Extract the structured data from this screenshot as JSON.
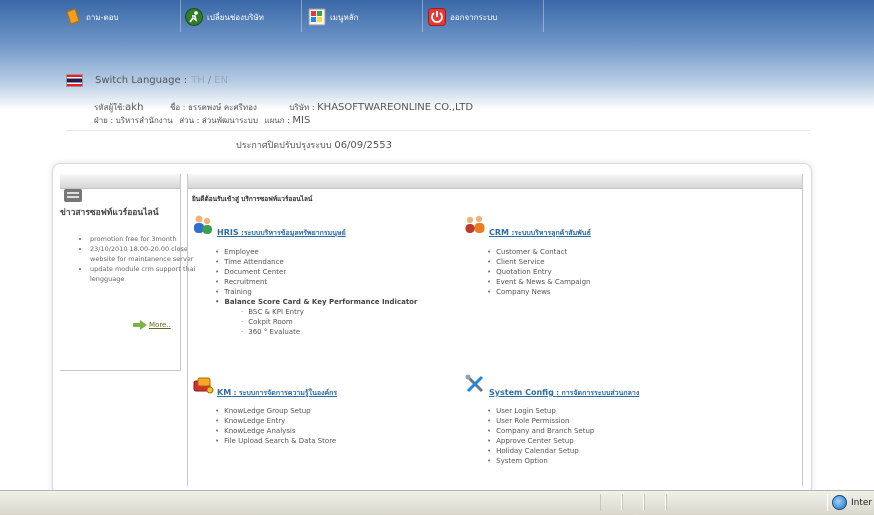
{
  "nav": {
    "items": [
      {
        "label": "ถาม-ตอบ",
        "icon": "qa-book-icon",
        "color": "#f0a020"
      },
      {
        "label": "เปลี่ยนช่องบริษัท",
        "icon": "runner-icon",
        "color": "#3c8f2f"
      },
      {
        "label": "เมนูหลัก",
        "icon": "windows-icon",
        "color": "#ffffff"
      },
      {
        "label": "ออกจากระบบ",
        "icon": "power-icon",
        "color": "#e03030"
      }
    ]
  },
  "language": {
    "label": "Switch Language :",
    "th": "TH",
    "sep": "/",
    "en": "EN"
  },
  "user": {
    "code_label": "รหัสผู้ใช้:",
    "code": "akh",
    "name_label": "ชื่อ :",
    "name": "ธรรคพงษ์ คะศรีทอง",
    "company_label": "บริษัท :",
    "company": "KHASOFTWAREONLINE CO.,LTD",
    "dept_label": "ฝ่าย :",
    "dept": "บริหารสำนักงาน",
    "section_label": "ส่วน :",
    "section": "ส่วนพัฒนาระบบ",
    "unit_label": "แผนก :",
    "unit": "MIS"
  },
  "notice": {
    "label": "ประกาศปิดปรับปรุงระบบ",
    "date": "06/09/2553"
  },
  "news": {
    "title": "ข่าวสารซอฟท์แวร์ออนไลน์",
    "items": [
      "promotion free for 3month",
      "23/10/2010 18.00-20.00 close website for maintanence server",
      "update module crm support thai lengguage"
    ],
    "more": "More.."
  },
  "main": {
    "welcome": "ยินดีต้อนรับเข้าสู่ บริการซอฟท์แวร์ออนไลน์",
    "modules": [
      {
        "code": "HRIS",
        "title": ":ระบบบริหารข้อมูลทรัพยากรมนุษย์",
        "items": [
          "Employee",
          "Time Attendance",
          "Document Center",
          "Recruitment",
          "Training",
          "Balance Score Card & Key Performance Indicator"
        ],
        "subitems": [
          "BSC & KPI Entry",
          "Cokpit Room",
          "360 ° Evaluate"
        ]
      },
      {
        "code": "CRM",
        "title": ":ระบบบริหารลูกค้าสัมพันธ์",
        "items": [
          "Customer & Contact",
          "Client Service",
          "Quotation Entry",
          "Event & News & Campaign",
          "Company News"
        ]
      },
      {
        "code": "KM",
        "title": ": ระบบการจัดการความรู้ในองค์กร",
        "items": [
          "KnowLedge Group Setup",
          "KnowLedge Entry",
          "KnowLedge Analysis",
          "File Upload Search & Data Store"
        ]
      },
      {
        "code": "System Config",
        "title": ": การจัดการระบบส่วนกลาง",
        "items": [
          "User Login Setup",
          "User Role Permission",
          "Company and Branch Setup",
          "Approve Center Setup",
          "Holiday Calendar Setup",
          "System Option"
        ]
      }
    ]
  },
  "statusbar": {
    "zone": "Inter"
  }
}
